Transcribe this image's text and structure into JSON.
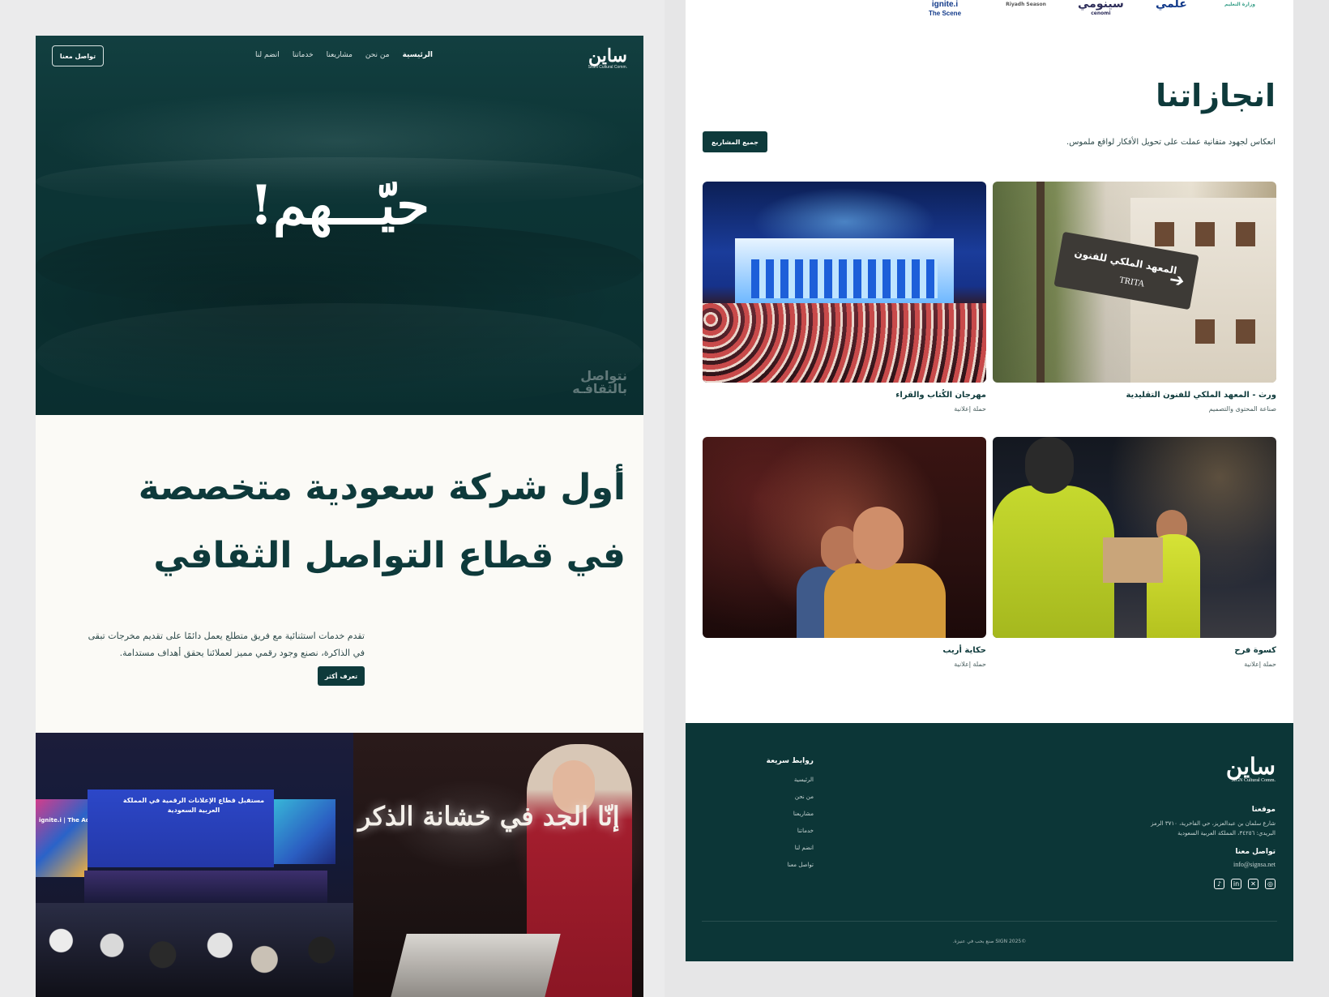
{
  "left": {
    "nav": {
      "logo": "ساين",
      "logo_sub": "SIGN Cultural Comm.",
      "items": [
        {
          "label": "الرئيسية",
          "active": true
        },
        {
          "label": "من نحن",
          "active": false
        },
        {
          "label": "مشاريعنا",
          "active": false
        },
        {
          "label": "خدماتنا",
          "active": false
        },
        {
          "label": "انضم لنا",
          "active": false
        }
      ],
      "cta": "تواصل معنا"
    },
    "hero": {
      "title": "حيّـــهم!",
      "watermark_line1": "نتواصل",
      "watermark_line2": "بالثقافـه"
    },
    "intro": {
      "headline_line1": "أول شركة سعودية متخصصة",
      "headline_line2": "في قطاع التواصل الثقافي",
      "body": "تقدم خدمات استثنائية مع فريق متطلع يعمل دائمًا على تقديم مخرجات تبقى في الذاكرة، نصنع وجود رقمي مميز لعملائنا يحقق أهداف مستدامة.",
      "button": "تعرف أكثر"
    },
    "gallery": {
      "conf_screen": "مستقبل قطاع الإعلانات الرقمية في المملكة العربية السعودية",
      "conf_logo": "ignite.i | The Ads",
      "book_calligraphy": "إنّا الجد في خشانة الذكر"
    }
  },
  "right": {
    "partners": [
      {
        "name": "ignite.i",
        "sub": "The Scene"
      },
      {
        "name": "Riyadh Season",
        "sub": ""
      },
      {
        "name": "سينومي",
        "sub": "cenomi"
      },
      {
        "name": "علمي",
        "sub": ""
      },
      {
        "name": "وزارة التعليم",
        "sub": ""
      }
    ],
    "achievements": {
      "title": "انجازاتنا",
      "subtitle": "انعكاس لجهود متفانية عملت على تحويل الأفكار لواقع ملموس.",
      "all_button": "جميع المشاريع",
      "cards": [
        {
          "title": "ورث - المعهد الملكي للفنون التقليدية",
          "tag": "صناعة المحتوى والتصميم",
          "sign_ar": "المعهد الملكي للفنون",
          "sign_en": "TRITA"
        },
        {
          "title": "مهرجان الكُتاب والقراء",
          "tag": "حملة إعلانية"
        },
        {
          "title": "كسوة فرح",
          "tag": "حملة إعلانية"
        },
        {
          "title": "حكاية أريب",
          "tag": "حملة إعلانية"
        }
      ]
    },
    "footer": {
      "logo": "ساين",
      "logo_sub": "SIGN Cultural Comm.",
      "location_heading": "موقعنا",
      "location": "شارع سلمان بن عبدالعزيز، حي الفاخرية، ٣٧١٠ الرمز البريدي: ٣٤٢٥٦، المملكة العربية السعودية",
      "contact_heading": "تواصل معنا",
      "email": "info@signsa.net",
      "social": [
        "instagram-icon",
        "x-icon",
        "linkedin-icon",
        "tiktok-icon"
      ],
      "links_heading": "روابط سريعة",
      "links": [
        "الرئيسية",
        "من نحن",
        "مشاريعنا",
        "خدماتنا",
        "انضم لنا",
        "تواصل معنا"
      ],
      "copyright": "©SIGN 2025 صنع بحب في عنيزة."
    }
  }
}
